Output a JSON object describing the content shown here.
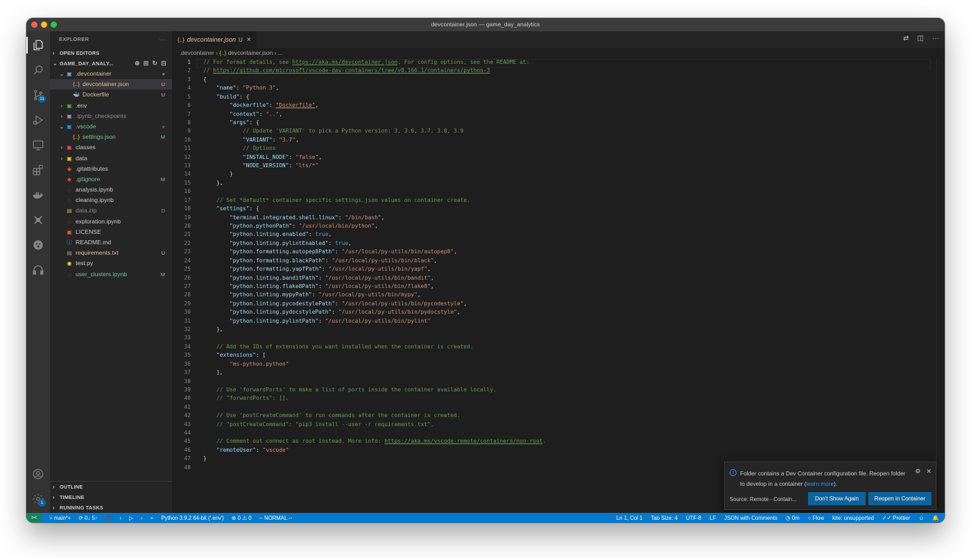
{
  "window": {
    "title": "devcontainer.json — game_day_analytics"
  },
  "colors": {
    "accent": "#007acc",
    "remote": "#16825d",
    "modified": "#e2c08d",
    "untracked": "#73c991",
    "button": "#0e639c"
  },
  "activity_bar": {
    "items": [
      {
        "name": "explorer-icon",
        "active": true
      },
      {
        "name": "search-icon"
      },
      {
        "name": "source-control-icon",
        "badge": "11"
      },
      {
        "name": "run-debug-icon"
      },
      {
        "name": "remote-explorer-icon"
      },
      {
        "name": "extensions-icon"
      },
      {
        "name": "docker-icon"
      },
      {
        "name": "kite-icon"
      },
      {
        "name": "paw-icon"
      },
      {
        "name": "headphones-icon"
      }
    ],
    "bottom": [
      {
        "name": "accounts-icon"
      },
      {
        "name": "manage-gear-icon",
        "badge": "1"
      }
    ]
  },
  "sidebar": {
    "title": "EXPLORER",
    "more": "···",
    "open_editors": "OPEN EDITORS",
    "workspace": "GAME_DAY_ANALY...",
    "tree": [
      {
        "label": ".devcontainer",
        "indent": 1,
        "twisty": "⌄",
        "icon": "▣",
        "icon_color": "#7fa8c9",
        "color": "#e2c08d",
        "status": "●",
        "status_color": "#8c8c4c"
      },
      {
        "label": "devcontainer.json",
        "indent": 2,
        "icon": "{..}",
        "icon_color": "#cbcb41",
        "color": "#e2c08d",
        "status": "U",
        "status_color": "#e2c08d",
        "selected": true
      },
      {
        "label": "Dockerfile",
        "indent": 2,
        "icon": "🐳",
        "icon_color": "#2496ed",
        "color": "#e2c08d",
        "status": "U",
        "status_color": "#e2c08d"
      },
      {
        "label": ".env",
        "indent": 1,
        "twisty": "›",
        "icon": "▣",
        "icon_color": "#4caf50",
        "color": "#cccccc"
      },
      {
        "label": ".ipynb_checkpoints",
        "indent": 1,
        "twisty": "›",
        "icon": "▣",
        "icon_color": "#90a4ae",
        "color": "#8c8c8c"
      },
      {
        "label": ".vscode",
        "indent": 1,
        "twisty": "⌄",
        "icon": "▣",
        "icon_color": "#2196f3",
        "color": "#73c991",
        "status": "●",
        "status_color": "#4d7a4d"
      },
      {
        "label": "settings.json",
        "indent": 2,
        "icon": "{..}",
        "icon_color": "#cbcb41",
        "color": "#73c991",
        "status": "M",
        "status_color": "#73c991"
      },
      {
        "label": "classes",
        "indent": 1,
        "twisty": "›",
        "icon": "▣",
        "icon_color": "#ef5350",
        "color": "#cccccc"
      },
      {
        "label": "data",
        "indent": 1,
        "twisty": "›",
        "icon": "▣",
        "icon_color": "#ffca28",
        "color": "#cccccc"
      },
      {
        "label": ".gitattributes",
        "indent": 1,
        "icon": "◆",
        "icon_color": "#e64a19",
        "color": "#cccccc"
      },
      {
        "label": ".gitignore",
        "indent": 1,
        "icon": "◆",
        "icon_color": "#e64a19",
        "color": "#73c991",
        "status": "M",
        "status_color": "#73c991"
      },
      {
        "label": "analysis.ipynb",
        "indent": 1,
        "icon": "◌",
        "icon_color": "#f57c00",
        "color": "#cccccc"
      },
      {
        "label": "cleaning.ipynb",
        "indent": 1,
        "icon": "◌",
        "icon_color": "#f57c00",
        "color": "#cccccc"
      },
      {
        "label": "data.zip",
        "indent": 1,
        "icon": "▤",
        "icon_color": "#afb42b",
        "color": "#8c8c8c",
        "status": "D",
        "status_color": "#8c8c8c"
      },
      {
        "label": "exploration.ipynb",
        "indent": 1,
        "icon": "◌",
        "icon_color": "#f57c00",
        "color": "#cccccc"
      },
      {
        "label": "LICENSE",
        "indent": 1,
        "icon": "▣",
        "icon_color": "#ff5722",
        "color": "#cccccc"
      },
      {
        "label": "README.md",
        "indent": 1,
        "icon": "ⓘ",
        "icon_color": "#42a5f5",
        "color": "#cccccc"
      },
      {
        "label": "requirements.txt",
        "indent": 1,
        "icon": "▤",
        "icon_color": "#a1887f",
        "color": "#e2c08d",
        "status": "U",
        "status_color": "#e2c08d"
      },
      {
        "label": "test.py",
        "indent": 1,
        "icon": "◉",
        "icon_color": "#ffd43b",
        "color": "#cccccc"
      },
      {
        "label": "user_clusters.ipynb",
        "indent": 1,
        "icon": "◌",
        "icon_color": "#f57c00",
        "color": "#73c991",
        "status": "M",
        "status_color": "#73c991"
      }
    ],
    "bottom_sections": [
      "OUTLINE",
      "TIMELINE",
      "RUNNING TASKS"
    ]
  },
  "tab": {
    "icon": "{..}",
    "label": "devcontainer.json",
    "status": "U",
    "close": "×"
  },
  "breadcrumbs": {
    "folder": ".devcontainer",
    "sep": "›",
    "file_icon": "{..}",
    "file": "devcontainer.json",
    "tail": "..."
  },
  "code_lines": [
    [
      [
        "c",
        "// For format details, see "
      ],
      [
        "cu",
        "https://aka.ms/devcontainer.json"
      ],
      [
        "c",
        ". For config options, see the README at:"
      ]
    ],
    [
      [
        "c",
        "// "
      ],
      [
        "cu",
        "https://github.com/microsoft/vscode-dev-containers/tree/v0.166.1/containers/python-3"
      ]
    ],
    [
      [
        "p",
        "{"
      ]
    ],
    [
      [
        "g",
        "    "
      ],
      [
        "k",
        "\"name\""
      ],
      [
        "p",
        ": "
      ],
      [
        "s",
        "\"Python 3\""
      ],
      [
        "p",
        ","
      ]
    ],
    [
      [
        "g",
        "    "
      ],
      [
        "k",
        "\"build\""
      ],
      [
        "p",
        ": {"
      ]
    ],
    [
      [
        "g",
        "        "
      ],
      [
        "k",
        "\"dockerfile\""
      ],
      [
        "p",
        ": "
      ],
      [
        "su",
        "\"Dockerfile\""
      ],
      [
        "p",
        ","
      ]
    ],
    [
      [
        "g",
        "        "
      ],
      [
        "k",
        "\"context\""
      ],
      [
        "p",
        ": "
      ],
      [
        "s",
        "\"..\""
      ],
      [
        "p",
        ","
      ]
    ],
    [
      [
        "g",
        "        "
      ],
      [
        "k",
        "\"args\""
      ],
      [
        "p",
        ": {"
      ]
    ],
    [
      [
        "g",
        "            "
      ],
      [
        "c",
        "// Update 'VARIANT' to pick a Python version: 3, 3.6, 3.7, 3.8, 3.9"
      ]
    ],
    [
      [
        "g",
        "            "
      ],
      [
        "k",
        "\"VARIANT\""
      ],
      [
        "p",
        ": "
      ],
      [
        "s",
        "\"3.7\""
      ],
      [
        "p",
        ","
      ]
    ],
    [
      [
        "g",
        "            "
      ],
      [
        "c",
        "// Options"
      ]
    ],
    [
      [
        "g",
        "            "
      ],
      [
        "k",
        "\"INSTALL_NODE\""
      ],
      [
        "p",
        ": "
      ],
      [
        "s",
        "\"false\""
      ],
      [
        "p",
        ","
      ]
    ],
    [
      [
        "g",
        "            "
      ],
      [
        "k",
        "\"NODE_VERSION\""
      ],
      [
        "p",
        ": "
      ],
      [
        "s",
        "\"lts/*\""
      ]
    ],
    [
      [
        "g",
        "        "
      ],
      [
        "p",
        "}"
      ]
    ],
    [
      [
        "g",
        "    "
      ],
      [
        "p",
        "},"
      ]
    ],
    [],
    [
      [
        "g",
        "    "
      ],
      [
        "c",
        "// Set *default* container specific settings.json values on container create."
      ]
    ],
    [
      [
        "g",
        "    "
      ],
      [
        "k",
        "\"settings\""
      ],
      [
        "p",
        ": {"
      ]
    ],
    [
      [
        "g",
        "        "
      ],
      [
        "k",
        "\"terminal.integrated.shell.linux\""
      ],
      [
        "p",
        ": "
      ],
      [
        "s",
        "\"/bin/bash\""
      ],
      [
        "p",
        ","
      ]
    ],
    [
      [
        "g",
        "        "
      ],
      [
        "k",
        "\"python.pythonPath\""
      ],
      [
        "p",
        ": "
      ],
      [
        "s",
        "\"/usr/local/bin/python\""
      ],
      [
        "p",
        ","
      ]
    ],
    [
      [
        "g",
        "        "
      ],
      [
        "k",
        "\"python.linting.enabled\""
      ],
      [
        "p",
        ": "
      ],
      [
        "b",
        "true"
      ],
      [
        "p",
        ","
      ]
    ],
    [
      [
        "g",
        "        "
      ],
      [
        "k",
        "\"python.linting.pylintEnabled\""
      ],
      [
        "p",
        ": "
      ],
      [
        "b",
        "true"
      ],
      [
        "p",
        ","
      ]
    ],
    [
      [
        "g",
        "        "
      ],
      [
        "k",
        "\"python.formatting.autopep8Path\""
      ],
      [
        "p",
        ": "
      ],
      [
        "s",
        "\"/usr/local/py-utils/bin/autopep8\""
      ],
      [
        "p",
        ","
      ]
    ],
    [
      [
        "g",
        "        "
      ],
      [
        "k",
        "\"python.formatting.blackPath\""
      ],
      [
        "p",
        ": "
      ],
      [
        "s",
        "\"/usr/local/py-utils/bin/black\""
      ],
      [
        "p",
        ","
      ]
    ],
    [
      [
        "g",
        "        "
      ],
      [
        "k",
        "\"python.formatting.yapfPath\""
      ],
      [
        "p",
        ": "
      ],
      [
        "s",
        "\"/usr/local/py-utils/bin/yapf\""
      ],
      [
        "p",
        ","
      ]
    ],
    [
      [
        "g",
        "        "
      ],
      [
        "k",
        "\"python.linting.banditPath\""
      ],
      [
        "p",
        ": "
      ],
      [
        "s",
        "\"/usr/local/py-utils/bin/bandit\""
      ],
      [
        "p",
        ","
      ]
    ],
    [
      [
        "g",
        "        "
      ],
      [
        "k",
        "\"python.linting.flake8Path\""
      ],
      [
        "p",
        ": "
      ],
      [
        "s",
        "\"/usr/local/py-utils/bin/flake8\""
      ],
      [
        "p",
        ","
      ]
    ],
    [
      [
        "g",
        "        "
      ],
      [
        "k",
        "\"python.linting.mypyPath\""
      ],
      [
        "p",
        ": "
      ],
      [
        "s",
        "\"/usr/local/py-utils/bin/mypy\""
      ],
      [
        "p",
        ","
      ]
    ],
    [
      [
        "g",
        "        "
      ],
      [
        "k",
        "\"python.linting.pycodestylePath\""
      ],
      [
        "p",
        ": "
      ],
      [
        "s",
        "\"/usr/local/py-utils/bin/pycodestyle\""
      ],
      [
        "p",
        ","
      ]
    ],
    [
      [
        "g",
        "        "
      ],
      [
        "k",
        "\"python.linting.pydocstylePath\""
      ],
      [
        "p",
        ": "
      ],
      [
        "s",
        "\"/usr/local/py-utils/bin/pydocstyle\""
      ],
      [
        "p",
        ","
      ]
    ],
    [
      [
        "g",
        "        "
      ],
      [
        "k",
        "\"python.linting.pylintPath\""
      ],
      [
        "p",
        ": "
      ],
      [
        "s",
        "\"/usr/local/py-utils/bin/pylint\""
      ]
    ],
    [
      [
        "g",
        "    "
      ],
      [
        "p",
        "},"
      ]
    ],
    [],
    [
      [
        "g",
        "    "
      ],
      [
        "c",
        "// Add the IDs of extensions you want installed when the container is created."
      ]
    ],
    [
      [
        "g",
        "    "
      ],
      [
        "k",
        "\"extensions\""
      ],
      [
        "p",
        ": ["
      ]
    ],
    [
      [
        "g",
        "        "
      ],
      [
        "s",
        "\"ms-python.python\""
      ]
    ],
    [
      [
        "g",
        "    "
      ],
      [
        "p",
        "],"
      ]
    ],
    [],
    [
      [
        "g",
        "    "
      ],
      [
        "c",
        "// Use 'forwardPorts' to make a list of ports inside the container available locally."
      ]
    ],
    [
      [
        "g",
        "    "
      ],
      [
        "c",
        "// \"forwardPorts\": [],"
      ]
    ],
    [],
    [
      [
        "g",
        "    "
      ],
      [
        "c",
        "// Use 'postCreateCommand' to run commands after the container is created."
      ]
    ],
    [
      [
        "g",
        "    "
      ],
      [
        "c",
        "// \"postCreateCommand\": \"pip3 install --user -r requirements.txt\","
      ]
    ],
    [],
    [
      [
        "g",
        "    "
      ],
      [
        "c",
        "// Comment out connect as root instead. More info: "
      ],
      [
        "cu",
        "https://aka.ms/vscode-remote/containers/non-root"
      ],
      [
        "c",
        "."
      ]
    ],
    [
      [
        "g",
        "    "
      ],
      [
        "k",
        "\"remoteUser\""
      ],
      [
        "p",
        ": "
      ],
      [
        "s",
        "\"vscode\""
      ]
    ],
    [
      [
        "p",
        "}"
      ]
    ],
    []
  ],
  "current_line": 1,
  "notification": {
    "message": "Folder contains a Dev Container configuration file. Reopen folder to develop in a container (",
    "link": "learn more",
    "message_end": ").",
    "source": "Source: Remote - Contain...",
    "dont_show": "Don't Show Again",
    "reopen": "Reopen in Container"
  },
  "statusbar": {
    "remote": "><",
    "branch": "main*+",
    "sync": "0↓ 5↑",
    "python": "Python 3.9.2 64-bit ('.env')",
    "problems": "⊗ 0 ⚠ 0",
    "mode": "-- NORMAL --",
    "position": "Ln 1, Col 1",
    "tab_size": "Tab Size: 4",
    "encoding": "UTF-8",
    "eol": "LF",
    "language": "JSON with Comments",
    "time": "0m",
    "flow": "Flow",
    "kite": "kite: unsupported",
    "prettier": "✓✓ Prettier"
  }
}
